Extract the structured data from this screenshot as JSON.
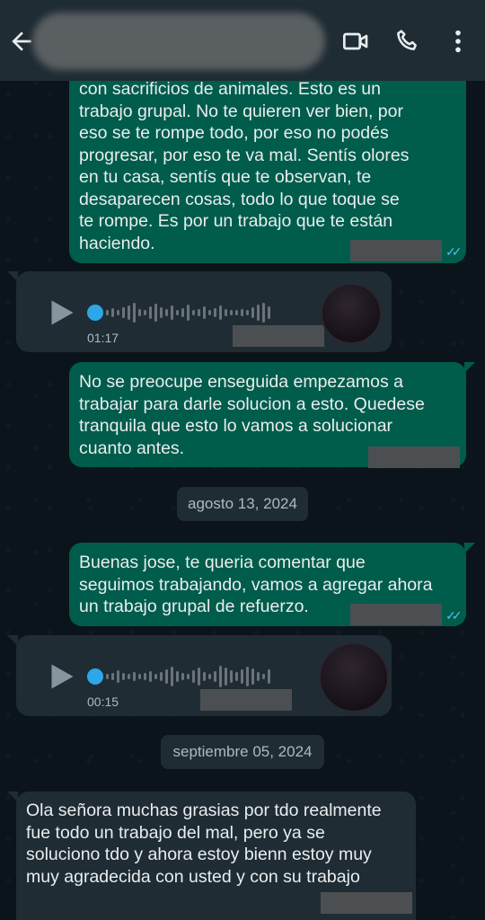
{
  "header": {
    "icons": [
      "back-arrow-icon",
      "video-call-icon",
      "phone-icon",
      "more-options-icon"
    ]
  },
  "messages": [
    {
      "type": "text",
      "direction": "outgoing",
      "text": "con sacrificios de animales. Esto es un\ntrabajo grupal. No te quieren ver bien, por\neso se te rompe todo, por eso no podés\nprogresar, por eso te va mal. Sentís olores\nen tu casa, sentís que te observan, te\ndesaparecen cosas, todo lo que toque se\nte rompe. Es por un trabajo que te están\nhaciendo.",
      "status": "read"
    },
    {
      "type": "voice",
      "direction": "incoming",
      "duration": "01:17"
    },
    {
      "type": "text",
      "direction": "outgoing",
      "text": "No se preocupe enseguida empezamos a\ntrabajar para darle solucion a esto. Quedese\ntranquila que esto lo vamos a solucionar\ncuanto antes.",
      "status": "read"
    },
    {
      "type": "date",
      "label": "agosto 13, 2024"
    },
    {
      "type": "text",
      "direction": "outgoing",
      "text": "Buenas jose, te queria comentar que\nseguimos trabajando, vamos a agregar ahora\nun trabajo grupal de refuerzo.",
      "status": "read"
    },
    {
      "type": "voice",
      "direction": "incoming",
      "duration": "00:15"
    },
    {
      "type": "date",
      "label": "septiembre 05, 2024"
    },
    {
      "type": "text",
      "direction": "incoming",
      "text": "Ola señora muchas grasias por tdo realmente\nfue todo un trabajo del mal, pero ya se\nsoluciono tdo y ahora estoy bienn estoy muy\nmuy agradecida con usted y con su trabajo"
    }
  ],
  "colors": {
    "chat_background": "#0b141a",
    "header_background": "#1f2c33",
    "outgoing_bubble": "#005c4b",
    "incoming_bubble": "#1f2c33",
    "read_ticks": "#53bdeb",
    "voice_accent": "#2ea7e8"
  }
}
